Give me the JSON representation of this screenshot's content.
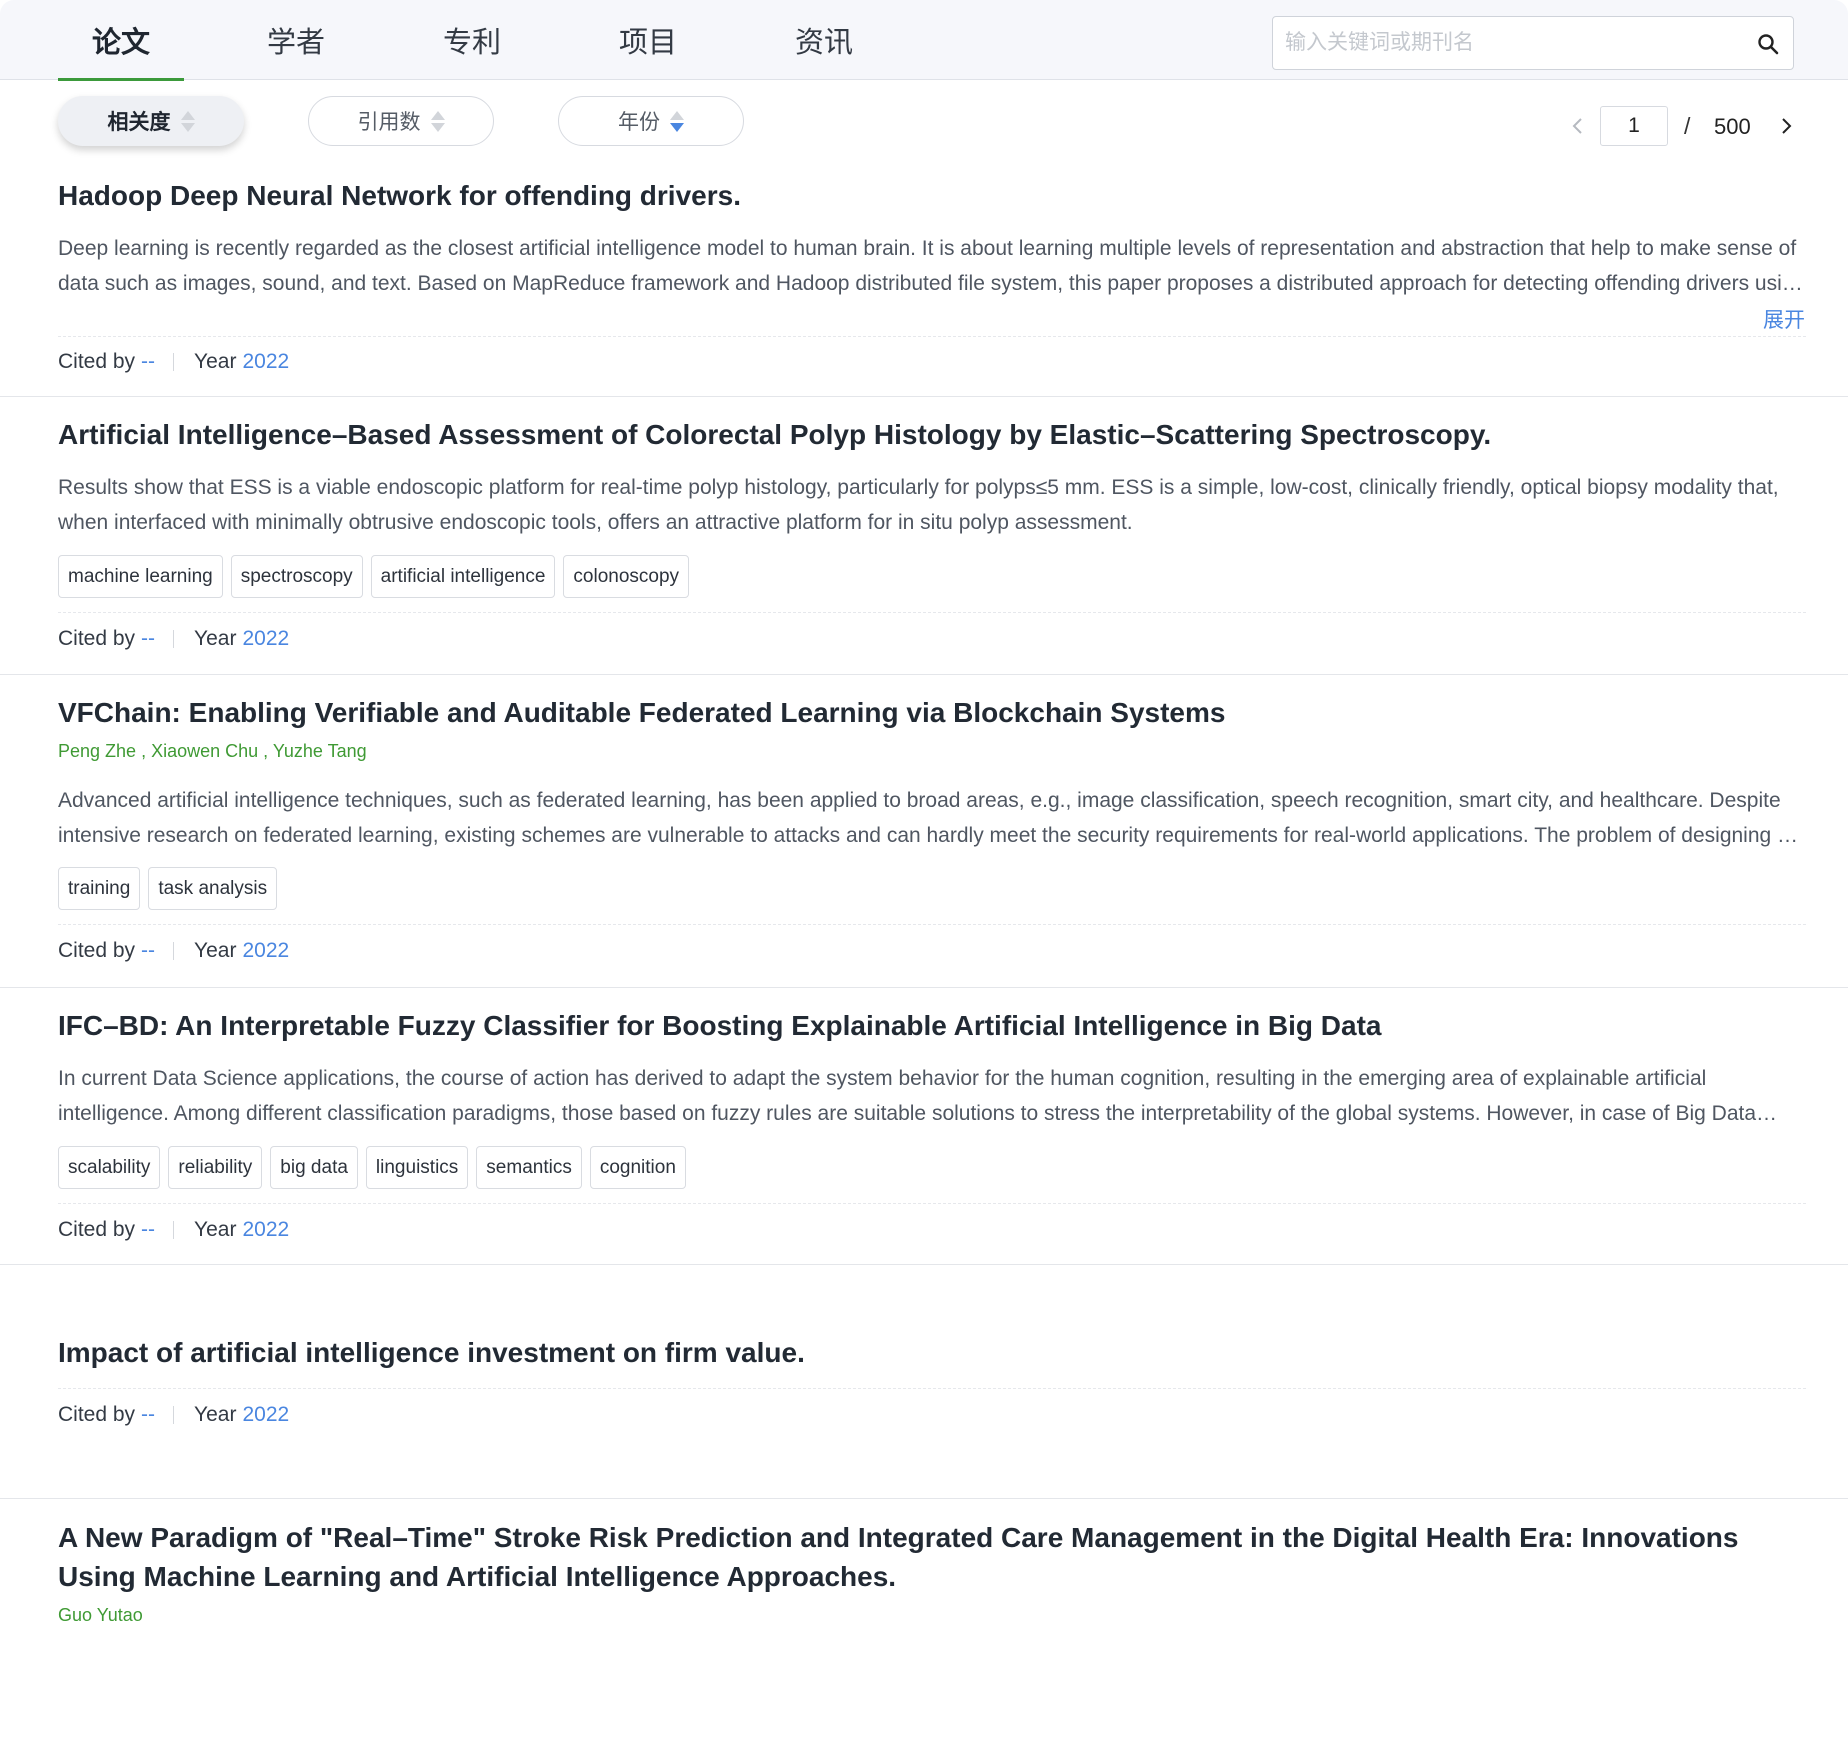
{
  "tabs": [
    {
      "label": "论文",
      "active": true
    },
    {
      "label": "学者",
      "active": false
    },
    {
      "label": "专利",
      "active": false
    },
    {
      "label": "项目",
      "active": false
    },
    {
      "label": "资讯",
      "active": false
    }
  ],
  "search": {
    "placeholder": "输入关键词或期刊名",
    "icon": "search-icon"
  },
  "sort": {
    "relevance": "相关度",
    "citations": "引用数",
    "year": "年份",
    "active": "relevance",
    "year_direction": "desc"
  },
  "pager": {
    "current": "1",
    "separator": "/",
    "total": "500"
  },
  "colors": {
    "accent_green": "#3b9a3b",
    "link_blue": "#4a86e0",
    "author_green": "#3f9a34"
  },
  "labels": {
    "cited_by": "Cited by",
    "year": "Year",
    "expand": "展开"
  },
  "results": [
    {
      "title": "Hadoop Deep Neural Network for offending drivers.",
      "abstract": "Deep learning is recently regarded as the closest artificial intelligence model to human brain. It is about learning multiple levels of representation and abstraction that help to make sense of data such as images, sound, and text. Based on MapReduce framework and Hadoop distributed file system, this paper proposes a distributed approach for detecting offending drivers using deep neural networks.",
      "cited_by": "--",
      "year": "2022"
    },
    {
      "title": "Artificial Intelligence–Based Assessment of Colorectal Polyp Histology by Elastic–Scattering Spectroscopy.",
      "abstract": "Results show that ESS is a viable endoscopic platform for real-time polyp histology, particularly for polyps≤5 mm. ESS is a simple, low-cost, clinically friendly, optical biopsy modality that, when interfaced with minimally obtrusive endoscopic tools, offers an attractive platform for in situ polyp assessment.",
      "tags": [
        "machine learning",
        "spectroscopy",
        "artificial intelligence",
        "colonoscopy"
      ],
      "cited_by": "--",
      "year": "2022"
    },
    {
      "title": "VFChain: Enabling Verifiable and Auditable Federated Learning via Blockchain Systems",
      "authors": [
        "Peng Zhe",
        "Xiaowen Chu",
        "Yuzhe Tang"
      ],
      "abstract": "Advanced artificial intelligence techniques, such as federated learning, has been applied to broad areas, e.g., image classification, speech recognition, smart city, and healthcare. Despite intensive research on federated learning, existing schemes are vulnerable to attacks and can hardly meet the security requirements for real-world applications. The problem of designing a secure federated learning framework remains open.",
      "tags": [
        "training",
        "task analysis"
      ],
      "cited_by": "--",
      "year": "2022"
    },
    {
      "title": "IFC–BD: An Interpretable Fuzzy Classifier for Boosting Explainable Artificial Intelligence in Big Data",
      "abstract": "In current Data Science applications, the course of action has derived to adapt the system behavior for the human cognition, resulting in the emerging area of explainable artificial intelligence. Among different classification paradigms, those based on fuzzy rules are suitable solutions to stress the interpretability of the global systems. However, in case of Big Data problems the number of rules may become too large.",
      "tags": [
        "scalability",
        "reliability",
        "big data",
        "linguistics",
        "semantics",
        "cognition"
      ],
      "cited_by": "--",
      "year": "2022"
    },
    {
      "title": "Impact of artificial intelligence investment on firm value.",
      "cited_by": "--",
      "year": "2022"
    },
    {
      "title": "A New Paradigm of \"Real–Time\" Stroke Risk Prediction and Integrated Care Management in the Digital Health Era: Innovations Using Machine Learning and Artificial Intelligence Approaches.",
      "authors": [
        "Guo Yutao"
      ]
    }
  ]
}
